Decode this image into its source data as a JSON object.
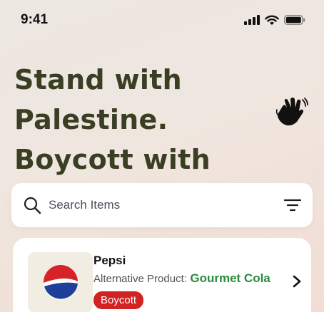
{
  "status_bar": {
    "time": "9:41",
    "icons": [
      "signal-icon",
      "wifi-icon",
      "battery-icon"
    ]
  },
  "header": {
    "headline": "Stand with Palestine. Boycott with purpose.",
    "emoji_icon": "waving-hand-icon"
  },
  "search": {
    "placeholder": "Search Items",
    "value": "",
    "icon": "search-icon",
    "filter_icon": "filter-icon"
  },
  "product": {
    "name": "Pepsi",
    "logo_icon": "pepsi-logo",
    "alternative_label": "Alternative Product:",
    "alternative_value": "Gourmet Cola",
    "badge": "Boycott",
    "chevron_icon": "chevron-right-icon"
  },
  "colors": {
    "headline": "#3a3e22",
    "alternative": "#2a8a3e",
    "badge_bg": "#d32222"
  }
}
